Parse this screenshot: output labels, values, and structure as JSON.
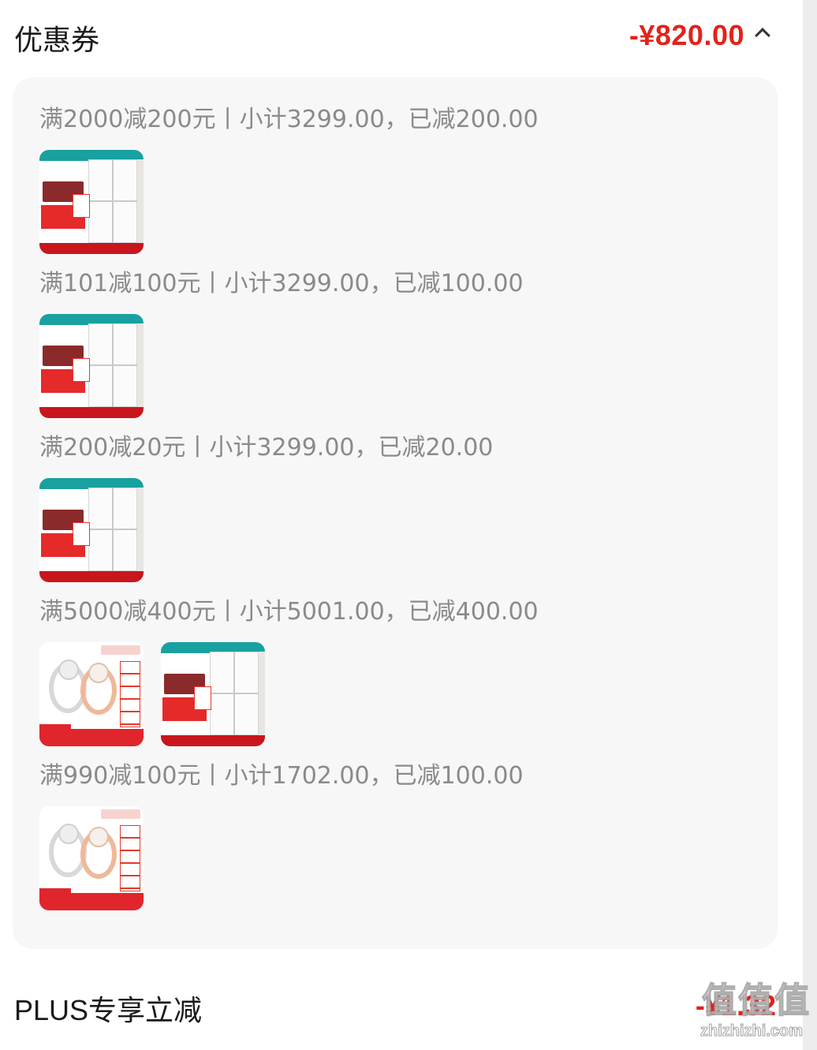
{
  "coupon_section": {
    "title": "优惠券",
    "total": "-¥820.00",
    "colors": {
      "accent": "#e2231a",
      "panel": "#f7f7f7",
      "muted_text": "#8a8a8a"
    },
    "groups": [
      {
        "label": "满2000减200元丨小计3299.00，已减200.00",
        "items": [
          "fridge"
        ]
      },
      {
        "label": "满101减100元丨小计3299.00，已减100.00",
        "items": [
          "fridge"
        ]
      },
      {
        "label": "满200减20元丨小计3299.00，已减20.00",
        "items": [
          "fridge"
        ]
      },
      {
        "label": "满5000减400元丨小计5001.00，已减400.00",
        "items": [
          "ring",
          "fridge"
        ]
      },
      {
        "label": "满990减100元丨小计1702.00，已减100.00",
        "items": [
          "ring"
        ]
      }
    ]
  },
  "plus_section": {
    "title": "PLUS专享立减",
    "value": "-¥1.32"
  },
  "watermark": {
    "logo": "值值值",
    "url": "zhizhizhi.com"
  },
  "icons": {
    "collapse": "chevron-up-icon"
  }
}
